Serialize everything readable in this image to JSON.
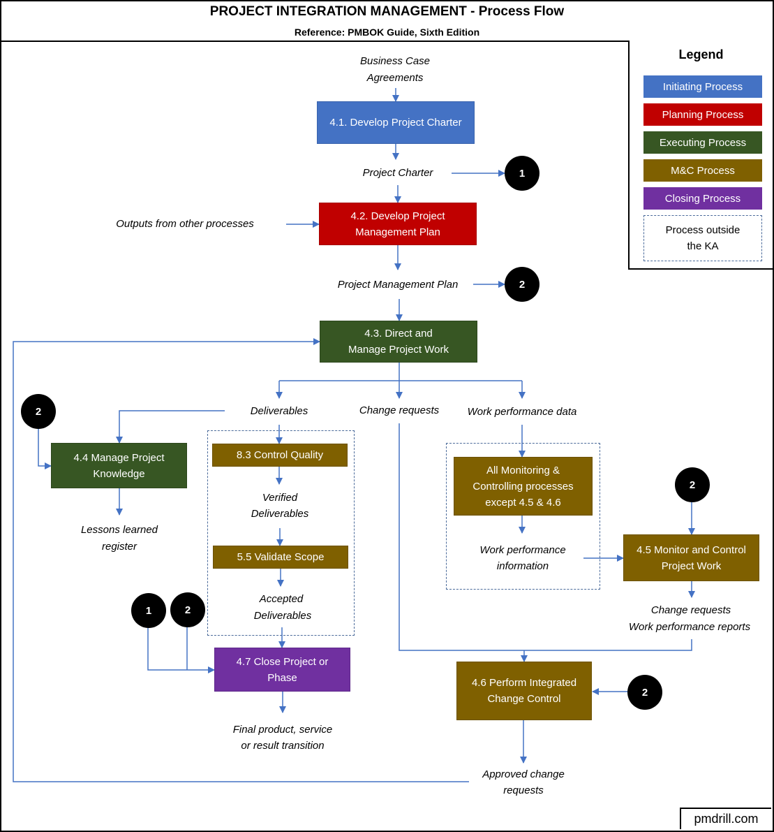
{
  "header": {
    "title": "PROJECT INTEGRATION MANAGEMENT - Process Flow",
    "subtitle": "Reference: PMBOK Guide, Sixth Edition"
  },
  "legend": {
    "title": "Legend",
    "items": [
      {
        "label": "Initiating Process",
        "color": "#4472c4"
      },
      {
        "label": "Planning Process",
        "color": "#c00000"
      },
      {
        "label": "Executing Process",
        "color": "#375623"
      },
      {
        "label": "M&C Process",
        "color": "#7f6000"
      },
      {
        "label": "Closing Process",
        "color": "#7030a0"
      }
    ],
    "outside_label": "Process outside the KA"
  },
  "processes": {
    "p41": {
      "label": "4.1. Develop Project Charter",
      "group": "Initiating"
    },
    "p42": {
      "label": "4.2. Develop Project Management Plan",
      "group": "Planning"
    },
    "p43": {
      "label": "4.3. Direct and Manage Project Work",
      "group": "Executing"
    },
    "p44": {
      "label": "4.4 Manage Project Knowledge",
      "group": "Executing"
    },
    "p83": {
      "label": "8.3 Control Quality",
      "group": "M&C"
    },
    "p55": {
      "label": "5.5 Validate Scope",
      "group": "M&C"
    },
    "p47": {
      "label": "4.7 Close Project or Phase",
      "group": "Closing"
    },
    "pmc": {
      "label": "All Monitoring & Controlling processes except 4.5 & 4.6",
      "group": "M&C"
    },
    "p45": {
      "label": "4.5 Monitor and Control Project Work",
      "group": "M&C"
    },
    "p46": {
      "label": "4.6 Perform Integrated Change Control",
      "group": "M&C"
    }
  },
  "artifacts": {
    "business_case": "Business Case",
    "agreements": "Agreements",
    "project_charter": "Project Charter",
    "outputs_other": "Outputs from other processes",
    "pm_plan": "Project Management Plan",
    "deliverables": "Deliverables",
    "change_requests": "Change requests",
    "wpd": "Work performance data",
    "lessons_1": "Lessons learned",
    "lessons_2": "register",
    "verified_1": "Verified",
    "verified_2": "Deliverables",
    "accepted_1": "Accepted",
    "accepted_2": "Deliverables",
    "wpi_1": "Work performance",
    "wpi_2": "information",
    "cr_45": "Change requests",
    "wpr": "Work performance reports",
    "final_1": "Final product, service",
    "final_2": "or result transition",
    "approved_1": "Approved change",
    "approved_2": "requests"
  },
  "connectors": {
    "c1": "1",
    "c2": "2"
  },
  "footer": {
    "site": "pmdrill.com"
  }
}
